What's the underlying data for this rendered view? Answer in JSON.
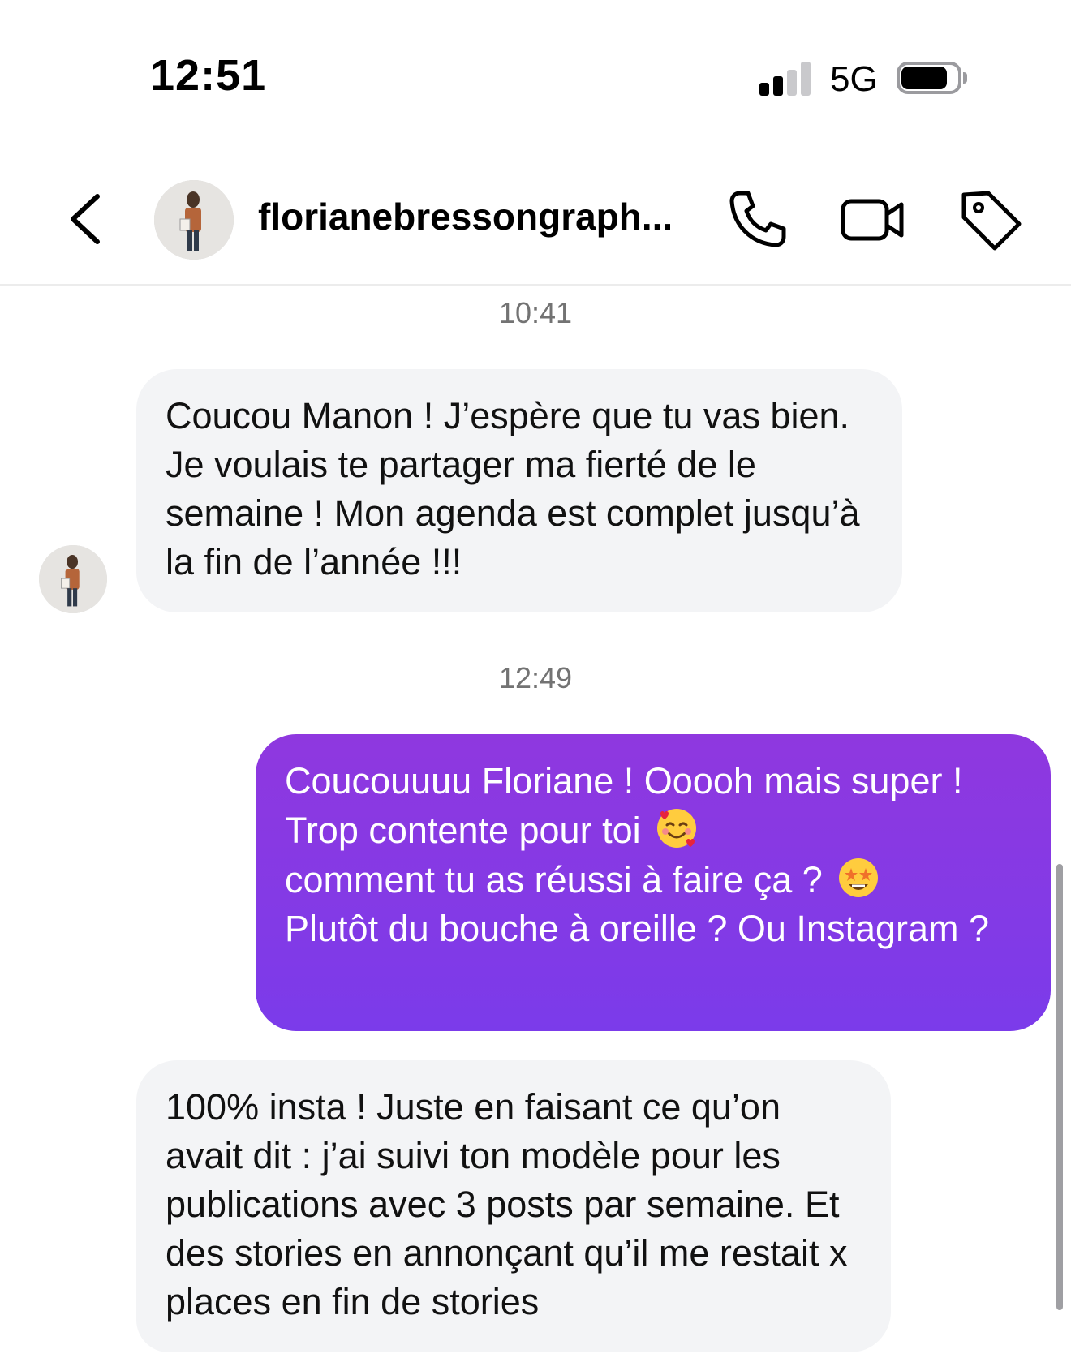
{
  "status_bar": {
    "time": "12:51",
    "network": "5G",
    "signal_icon": "cellular-signal-icon",
    "battery_icon": "battery-icon"
  },
  "header": {
    "back_icon": "chevron-left-icon",
    "username": "florianebressongraph...",
    "call_icon": "phone-icon",
    "video_icon": "video-camera-icon",
    "tag_icon": "tag-icon"
  },
  "messages": {
    "ts1": "10:41",
    "m1": "Coucou Manon ! J’espère que tu vas bien. Je voulais te partager ma fierté de le semaine ! Mon agenda est complet jusqu’à la fin de l’année !!!",
    "ts2": "12:49",
    "m2_part1": "Coucouuuu Floriane ! Ooooh mais super ! Trop contente pour toi",
    "m2_part2": "comment tu as réussi à faire ça ?",
    "m2_part3": "Plutôt du bouche à oreille ? Ou Instagram ?",
    "m3": "100% insta ! Juste en faisant ce qu’on avait dit : j’ai suivi ton modèle pour les publications avec 3 posts par semaine. Et des stories en annonçant qu’il me restait x places en fin de stories"
  },
  "colors": {
    "sent_bubble_top": "#8f38df",
    "sent_bubble_bottom": "#7b3bea",
    "received_bubble": "#f3f4f6",
    "timestamp": "#737373"
  }
}
